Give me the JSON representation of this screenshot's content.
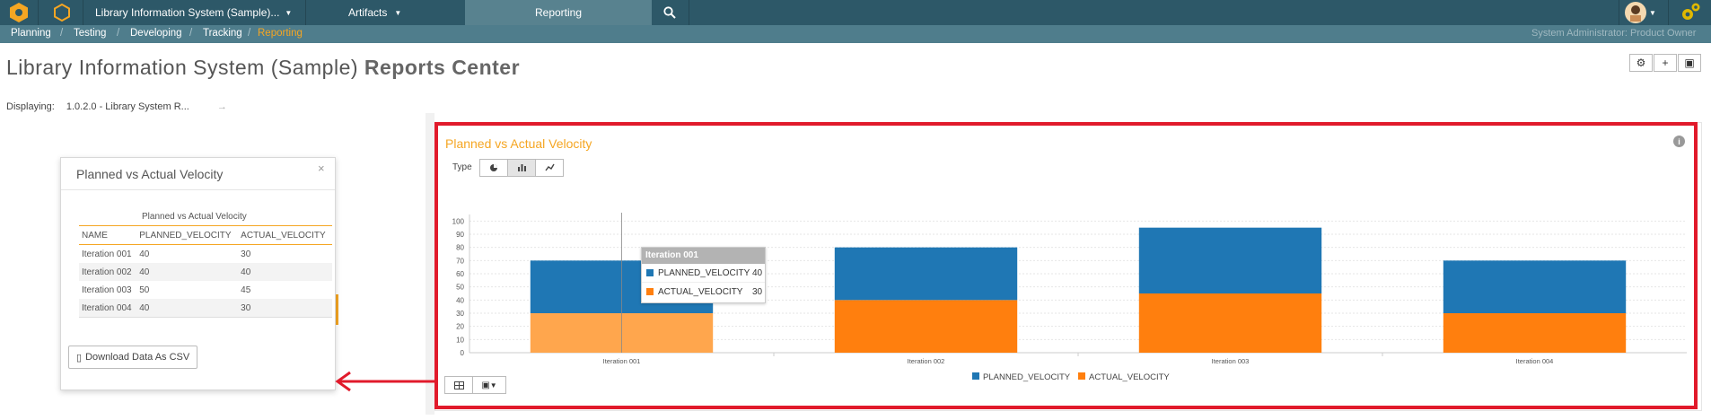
{
  "topbar": {
    "project_label": "Library Information System (Sample)...",
    "artifacts_label": "Artifacts",
    "reporting_label": "Reporting"
  },
  "subnav": {
    "items": [
      "Planning",
      "Testing",
      "Developing",
      "Tracking",
      "Reporting"
    ],
    "user_role": "System Administrator: Product Owner"
  },
  "page": {
    "title_normal": "Library Information System (Sample)",
    "title_bold": "Reports Center",
    "displaying_label": "Displaying:",
    "displaying_value": "1.0.2.0 - Library System R..."
  },
  "popup": {
    "title": "Planned vs Actual Velocity",
    "table_caption": "Planned vs Actual Velocity",
    "columns": [
      "NAME",
      "PLANNED_VELOCITY",
      "ACTUAL_VELOCITY"
    ],
    "rows": [
      [
        "Iteration 001",
        "40",
        "30"
      ],
      [
        "Iteration 002",
        "40",
        "40"
      ],
      [
        "Iteration 003",
        "50",
        "45"
      ],
      [
        "Iteration 004",
        "40",
        "30"
      ]
    ],
    "download_label": "Download Data As CSV"
  },
  "widget": {
    "title": "Planned vs Actual Velocity",
    "type_label": "Type"
  },
  "tooltip": {
    "title": "Iteration 001",
    "rows": [
      {
        "name": "PLANNED_VELOCITY",
        "value": "40"
      },
      {
        "name": "ACTUAL_VELOCITY",
        "value": "30"
      }
    ]
  },
  "chart_data": {
    "type": "bar",
    "stacked": true,
    "categories": [
      "Iteration 001",
      "Iteration 002",
      "Iteration 003",
      "Iteration 004"
    ],
    "series": [
      {
        "name": "ACTUAL_VELOCITY",
        "values": [
          30,
          40,
          45,
          30
        ],
        "color": "#ff7f0e"
      },
      {
        "name": "PLANNED_VELOCITY",
        "values": [
          40,
          40,
          50,
          40
        ],
        "color": "#1f77b4"
      }
    ],
    "yticks": [
      0,
      10,
      20,
      30,
      40,
      50,
      60,
      70,
      80,
      90,
      100
    ],
    "ylim": [
      0,
      105
    ],
    "legend_position": "bottom-center",
    "grid": true
  },
  "colors": {
    "accent": "#f5a623",
    "topbar": "#2d5868",
    "highlight_box": "#e11a2b"
  }
}
